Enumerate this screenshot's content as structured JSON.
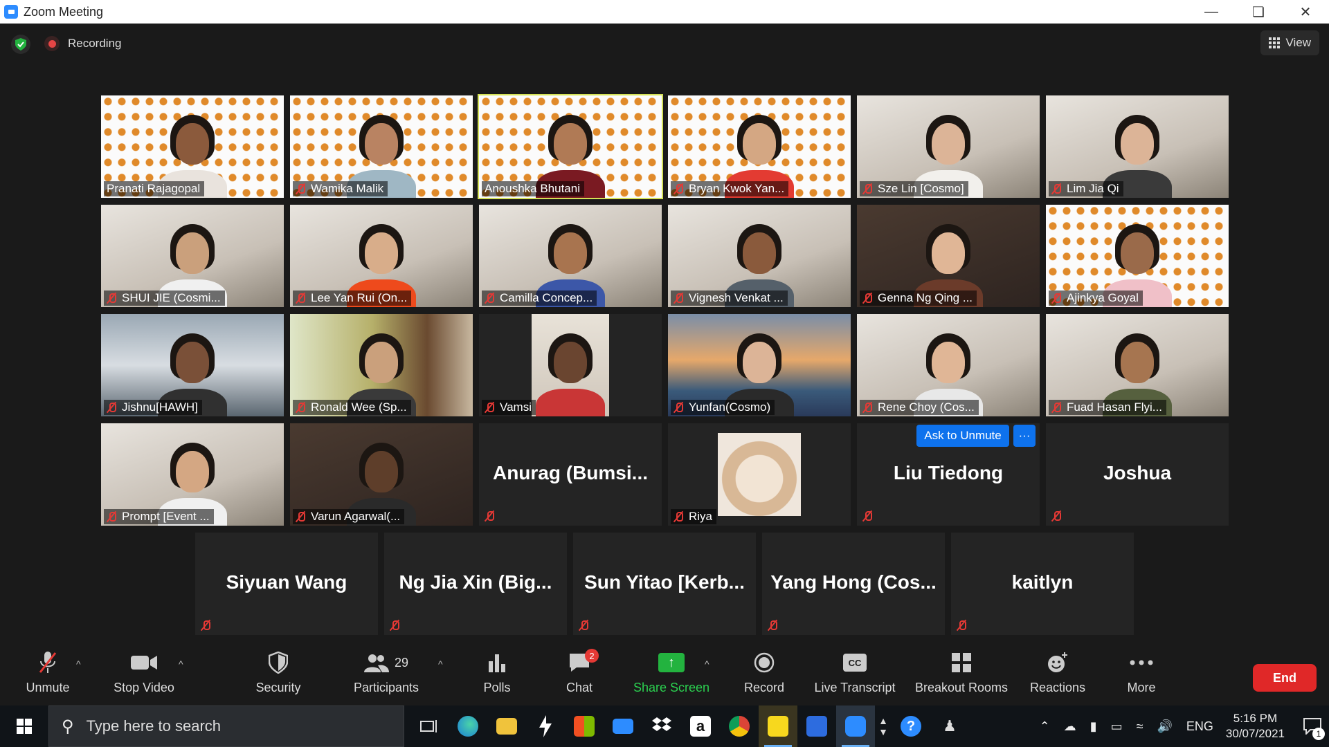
{
  "window": {
    "title": "Zoom Meeting"
  },
  "topbar": {
    "recording_label": "Recording",
    "view_label": "View"
  },
  "video_tiles": [
    {
      "name": "Pranati Rajagopal",
      "muted": false,
      "bg": "bulbs",
      "skin": "#8b5a3c",
      "shirt": "#e9e3dd"
    },
    {
      "name": "Wamika Malik",
      "muted": true,
      "bg": "bulbs",
      "skin": "#b98362",
      "shirt": "#9fb7c4"
    },
    {
      "name": "Anoushka Bhutani",
      "muted": false,
      "bg": "bulbs",
      "skin": "#b07a55",
      "shirt": "#7a1a22",
      "active": true
    },
    {
      "name": "Bryan Kwok Yan...",
      "muted": true,
      "bg": "bulbs",
      "skin": "#d4a783",
      "shirt": "#e33b32"
    },
    {
      "name": "Sze Lin [Cosmo]",
      "muted": true,
      "bg": "room",
      "skin": "#dcb497",
      "shirt": "#f2f0ec"
    },
    {
      "name": "Lim Jia Qi",
      "muted": true,
      "bg": "room",
      "skin": "#dcb497",
      "shirt": "#3a3a3a"
    },
    {
      "name": "SHUI JIE (Cosmi...",
      "muted": true,
      "bg": "room",
      "skin": "#caa07c",
      "shirt": "#f0f0f0"
    },
    {
      "name": "Lee Yan Rui (On...",
      "muted": true,
      "bg": "room",
      "skin": "#d8ad8a",
      "shirt": "#ee4a1c"
    },
    {
      "name": "Camilla Concep...",
      "muted": true,
      "bg": "room",
      "skin": "#a8744f",
      "shirt": "#3c57a8"
    },
    {
      "name": "Vignesh Venkat ...",
      "muted": true,
      "bg": "room",
      "skin": "#8a5a3c",
      "shirt": "#55606a"
    },
    {
      "name": "Genna Ng Qing ...",
      "muted": true,
      "bg": "dark",
      "skin": "#e0b696",
      "shirt": "#6b3b2a"
    },
    {
      "name": "Ajinkya Goyal",
      "muted": true,
      "bg": "bulbs",
      "skin": "#9a6a4a",
      "shirt": "#f0c0c8"
    },
    {
      "name": "Jishnu[HAWH]",
      "muted": true,
      "bg": "car",
      "skin": "#7a5038",
      "shirt": "#303030"
    },
    {
      "name": "Ronald Wee (Sp...",
      "muted": true,
      "bg": "shelf",
      "skin": "#caa07c",
      "shirt": "#3a3a3a"
    },
    {
      "name": "Vamsi",
      "muted": true,
      "bg": "narrow",
      "skin": "#6a4530",
      "shirt": "#c93636"
    },
    {
      "name": "Yunfan(Cosmo)",
      "muted": true,
      "bg": "bridge",
      "skin": "#dcb497",
      "shirt": "#2a2a2a"
    },
    {
      "name": "Rene Choy (Cos...",
      "muted": true,
      "bg": "room",
      "skin": "#e0b696",
      "shirt": "#e8e8e8"
    },
    {
      "name": "Fuad Hasan Flyi...",
      "muted": true,
      "bg": "room",
      "skin": "#a67550",
      "shirt": "#56603e"
    },
    {
      "name": "Prompt [Event ...",
      "muted": true,
      "bg": "room",
      "skin": "#d4a783",
      "shirt": "#f0f0f0"
    },
    {
      "name": "Varun Agarwal(...",
      "muted": true,
      "bg": "dark",
      "skin": "#5e3e2a",
      "shirt": "#2a2a2a"
    }
  ],
  "name_tiles": [
    {
      "big": "Anurag  (Bumsi...",
      "small": ""
    },
    {
      "big": "",
      "small": "Riya"
    },
    {
      "big": "Liu Tiedong",
      "small": ""
    },
    {
      "big": "Joshua",
      "small": ""
    },
    {
      "big": "Siyuan Wang",
      "small": ""
    },
    {
      "big": "Ng Jia Xin (Big...",
      "small": ""
    },
    {
      "big": "Sun Yitao [Kerb...",
      "small": ""
    },
    {
      "big": "Yang Hong (Cos...",
      "small": ""
    },
    {
      "big": "kaitlyn",
      "small": ""
    }
  ],
  "hover_actions": {
    "ask_unmute": "Ask to Unmute",
    "more": "···"
  },
  "toolbar": {
    "unmute": "Unmute",
    "stop_video": "Stop Video",
    "security": "Security",
    "participants": "Participants",
    "participants_count": "29",
    "polls": "Polls",
    "chat": "Chat",
    "chat_badge": "2",
    "share_screen": "Share Screen",
    "record": "Record",
    "live_transcript": "Live Transcript",
    "breakout_rooms": "Breakout Rooms",
    "reactions": "Reactions",
    "more": "More",
    "end": "End"
  },
  "taskbar": {
    "search_placeholder": "Type here to search",
    "language": "ENG",
    "time": "5:16 PM",
    "date": "30/07/2021",
    "notifications": "1"
  },
  "colors": {
    "accent_blue": "#0e72ed",
    "end_red": "#e02828",
    "share_green": "#23b33f",
    "mute_red": "#e53935",
    "active_speaker": "#d4e157"
  }
}
